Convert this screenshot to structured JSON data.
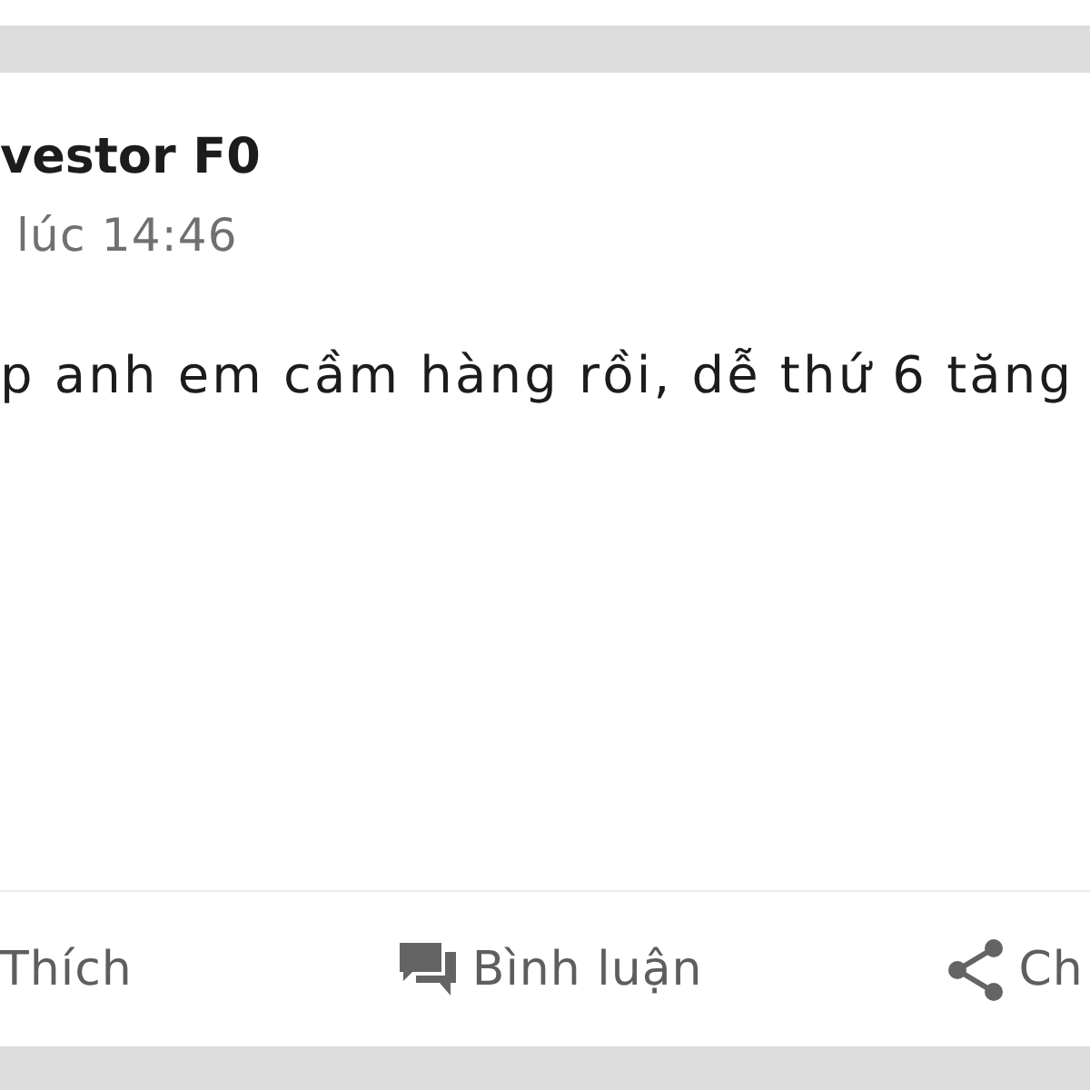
{
  "post": {
    "author": "vestor F0",
    "time": "lúc 14:46",
    "text": "p anh em cầm hàng rồi, dễ thứ 6 tăng"
  },
  "actions": [
    {
      "kind": "like",
      "label": "Thích"
    },
    {
      "kind": "comment",
      "label": "Bình luận"
    },
    {
      "kind": "share",
      "label": "Ch"
    }
  ]
}
